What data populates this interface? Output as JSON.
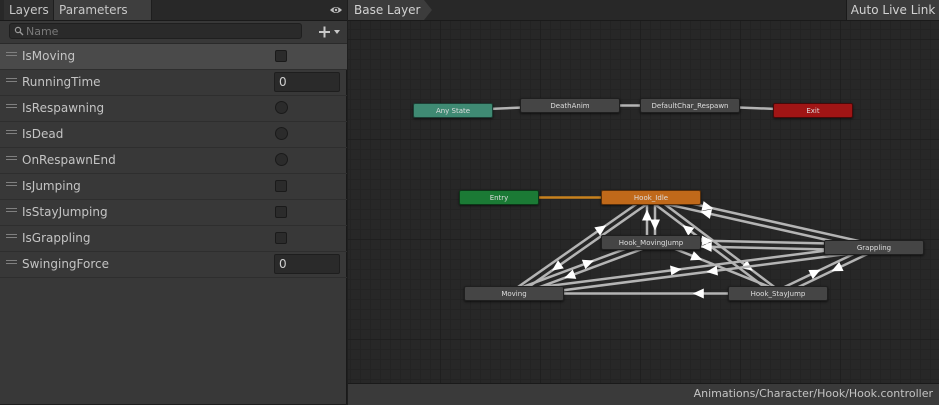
{
  "tabs": {
    "layers": "Layers",
    "parameters": "Parameters"
  },
  "search": {
    "placeholder": "Name"
  },
  "parameters": [
    {
      "name": "IsMoving",
      "type": "bool",
      "selected": true
    },
    {
      "name": "RunningTime",
      "type": "float",
      "value": "0"
    },
    {
      "name": "IsRespawning",
      "type": "trigger"
    },
    {
      "name": "IsDead",
      "type": "trigger"
    },
    {
      "name": "OnRespawnEnd",
      "type": "trigger"
    },
    {
      "name": "IsJumping",
      "type": "bool"
    },
    {
      "name": "IsStayJumping",
      "type": "bool"
    },
    {
      "name": "IsGrappling",
      "type": "bool"
    },
    {
      "name": "SwingingForce",
      "type": "float",
      "value": "0"
    }
  ],
  "breadcrumb": "Base Layer",
  "auto_live_link": "Auto Live Link",
  "footer_path": "Animations/Character/Hook/Hook.controller",
  "states": {
    "any_state": "Any State",
    "death_anim": "DeathAnim",
    "default_respawn": "DefaultChar_Respawn",
    "exit": "Exit",
    "entry": "Entry",
    "hook_idle": "Hook_Idle",
    "hook_moving_jump": "Hook_MovingJump",
    "grappling": "Grappling",
    "moving": "Moving",
    "hook_stay_jump": "Hook_StayJump"
  },
  "colors": {
    "any_state": "#3f8a73",
    "default_state": "#c0691a",
    "entry": "#1b7a35",
    "exit": "#a01515",
    "state": "#454545",
    "transition": "#b4b4b4",
    "entry_transition": "#c8821e"
  },
  "icons": {
    "eye": "eye-icon",
    "search": "search-icon",
    "add": "plus-icon",
    "handle": "drag-handle-icon"
  }
}
